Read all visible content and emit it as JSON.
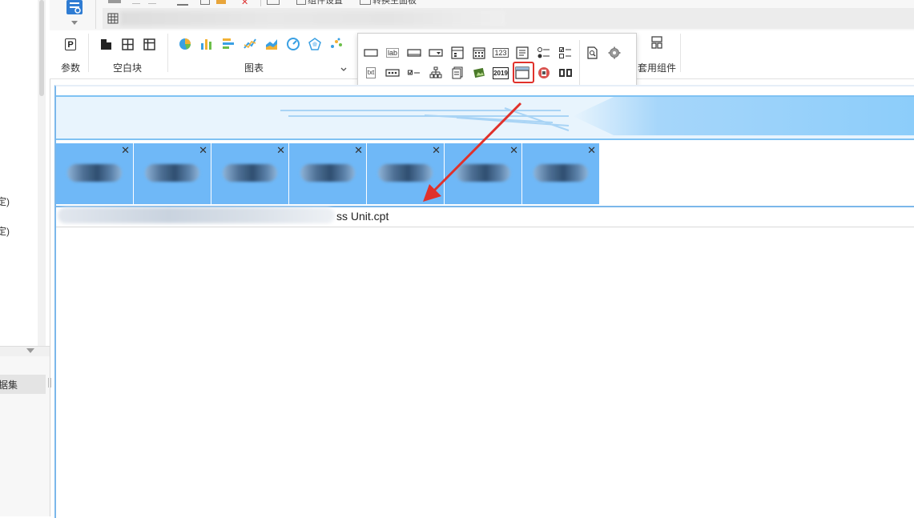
{
  "left_panel": {
    "item1_suffix": "定)",
    "item2_suffix": "定)",
    "dataset_tab_label": "据集"
  },
  "toolbar": {
    "partial_label_1": "组件设置",
    "partial_label_2": "转换主面板"
  },
  "ribbon": {
    "param_label": "参数",
    "blank_block_label": "空白块",
    "chart_label": "图表",
    "template_component_label": "套用组件",
    "param_icon_glyph": "P"
  },
  "popup": {
    "text_icon_label": "lab",
    "number_icon_label": "123",
    "txt_icon_label": "txt",
    "date_icon_label": "2019",
    "highlighted_item": "tab-component"
  },
  "canvas": {
    "tab_close_glyph": "✕",
    "tab_count": 7,
    "cell_text": "ss Unit.cpt"
  },
  "colors": {
    "accent_blue": "#6fb8f7",
    "highlight_red": "#e0312b",
    "banner_light": "#e8f4fd",
    "banner_dark": "#8ccdfa"
  }
}
